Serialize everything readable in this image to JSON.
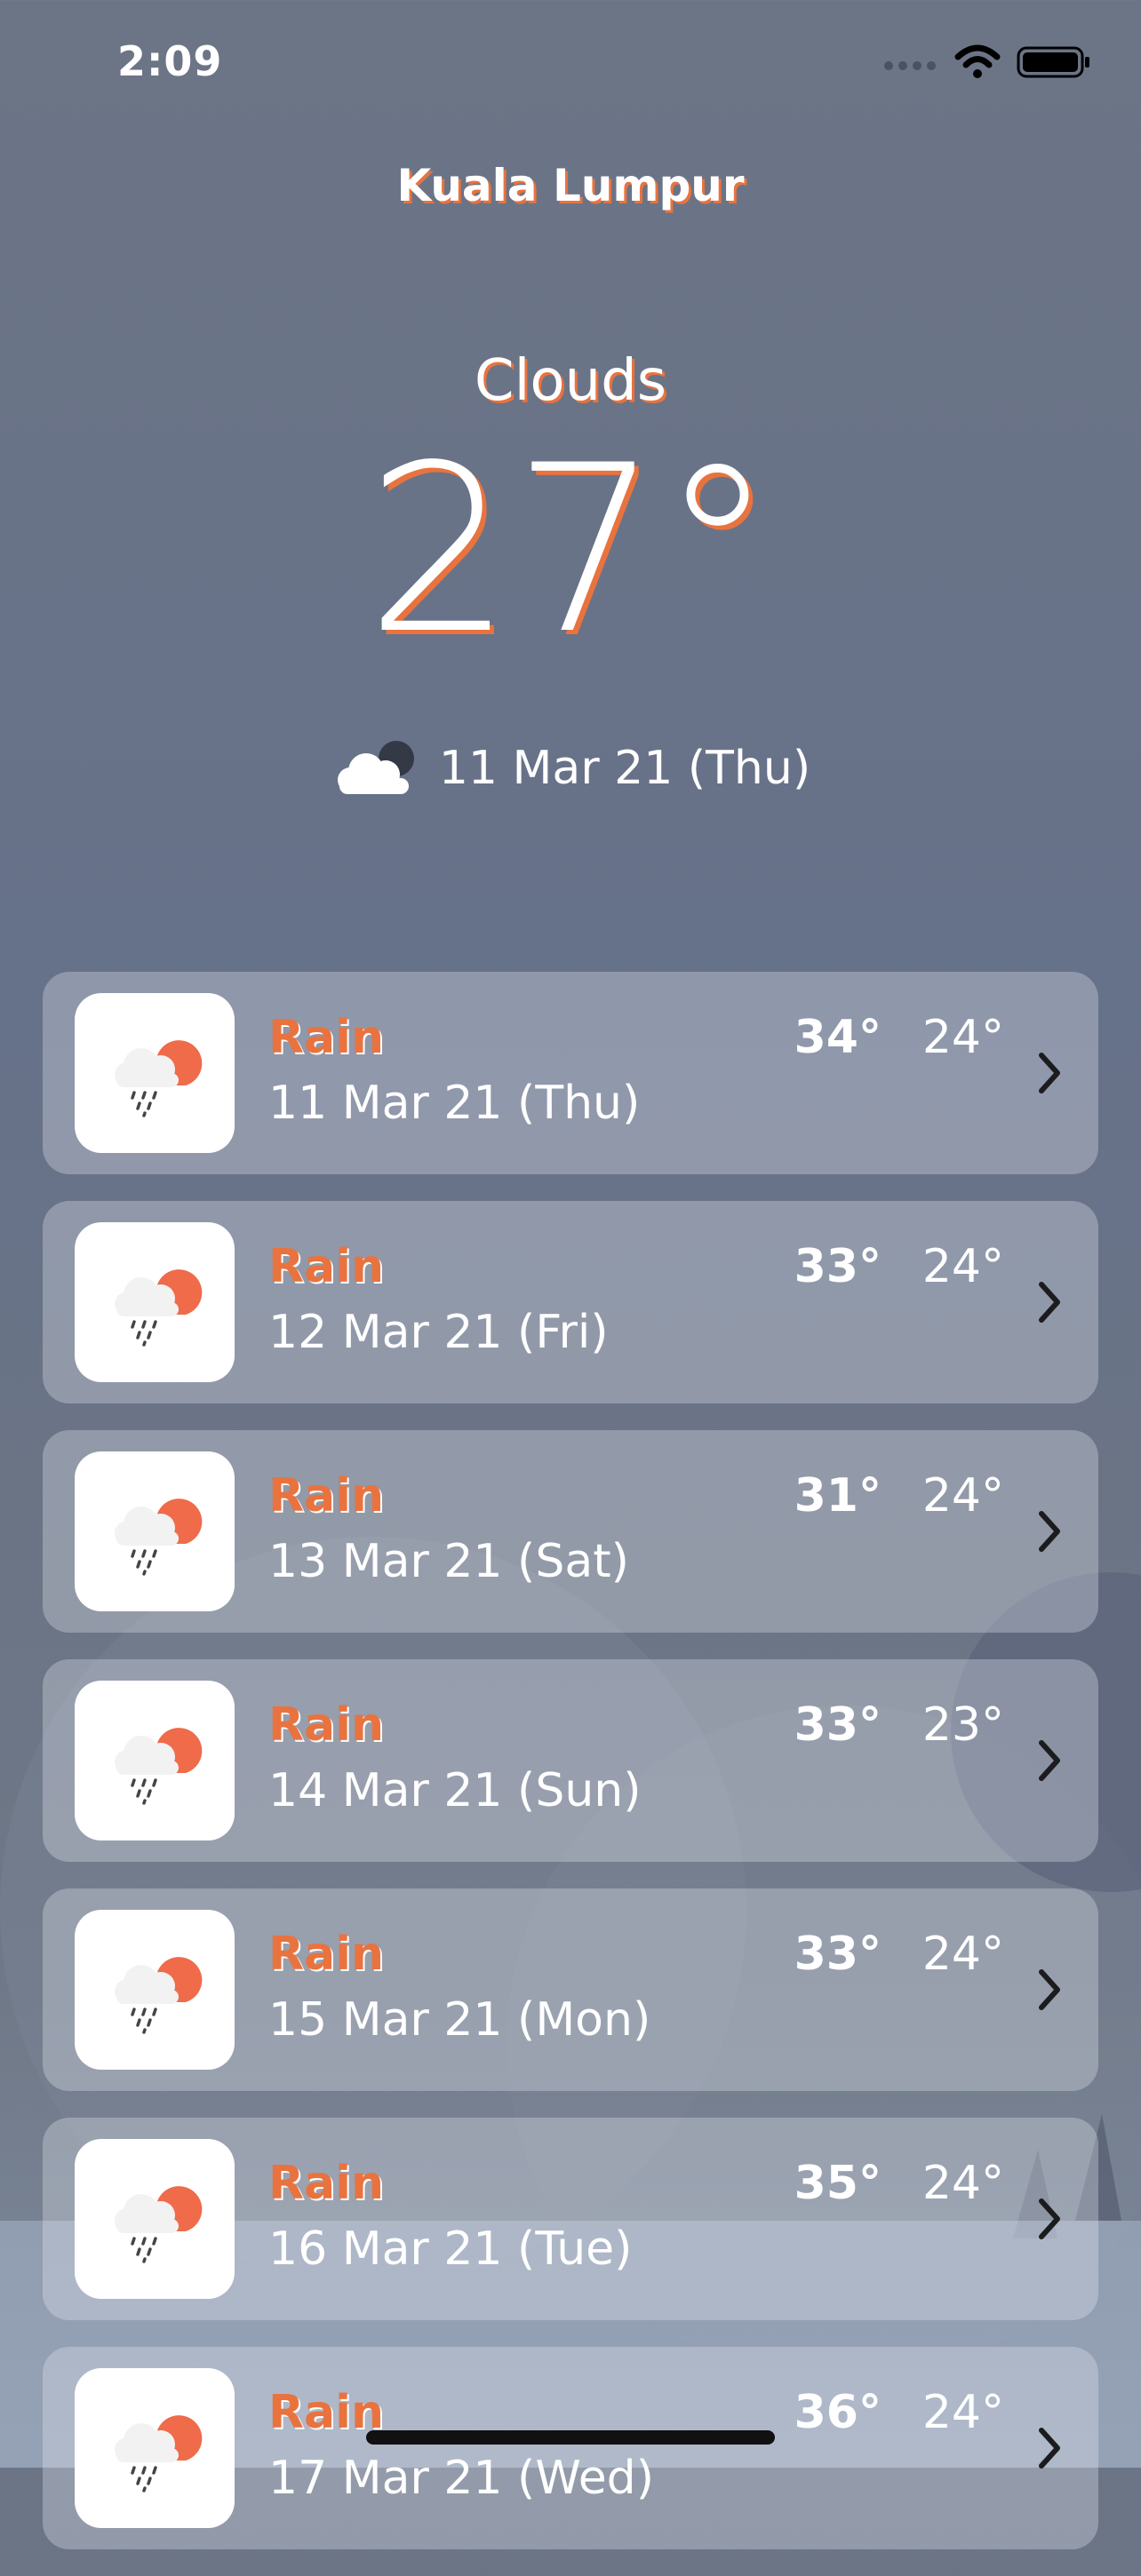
{
  "status_bar": {
    "time": "2:09"
  },
  "header": {
    "city": "Kuala Lumpur",
    "condition": "Clouds",
    "temperature": "27°",
    "date": "11 Mar 21 (Thu)",
    "icon": "cloud-night-icon"
  },
  "forecast": [
    {
      "condition": "Rain",
      "date": "11 Mar 21 (Thu)",
      "high": "34°",
      "low": "24°",
      "icon": "rain-sun-icon"
    },
    {
      "condition": "Rain",
      "date": "12 Mar 21 (Fri)",
      "high": "33°",
      "low": "24°",
      "icon": "rain-sun-icon"
    },
    {
      "condition": "Rain",
      "date": "13 Mar 21 (Sat)",
      "high": "31°",
      "low": "24°",
      "icon": "rain-sun-icon"
    },
    {
      "condition": "Rain",
      "date": "14 Mar 21 (Sun)",
      "high": "33°",
      "low": "23°",
      "icon": "rain-sun-icon"
    },
    {
      "condition": "Rain",
      "date": "15 Mar 21 (Mon)",
      "high": "33°",
      "low": "24°",
      "icon": "rain-sun-icon"
    },
    {
      "condition": "Rain",
      "date": "16 Mar 21 (Tue)",
      "high": "35°",
      "low": "24°",
      "icon": "rain-sun-icon"
    },
    {
      "condition": "Rain",
      "date": "17 Mar 21 (Wed)",
      "high": "36°",
      "low": "24°",
      "icon": "rain-sun-icon"
    }
  ],
  "colors": {
    "accent": "#e8733f",
    "background": "#6a7487",
    "card": "#a3a9b4"
  }
}
